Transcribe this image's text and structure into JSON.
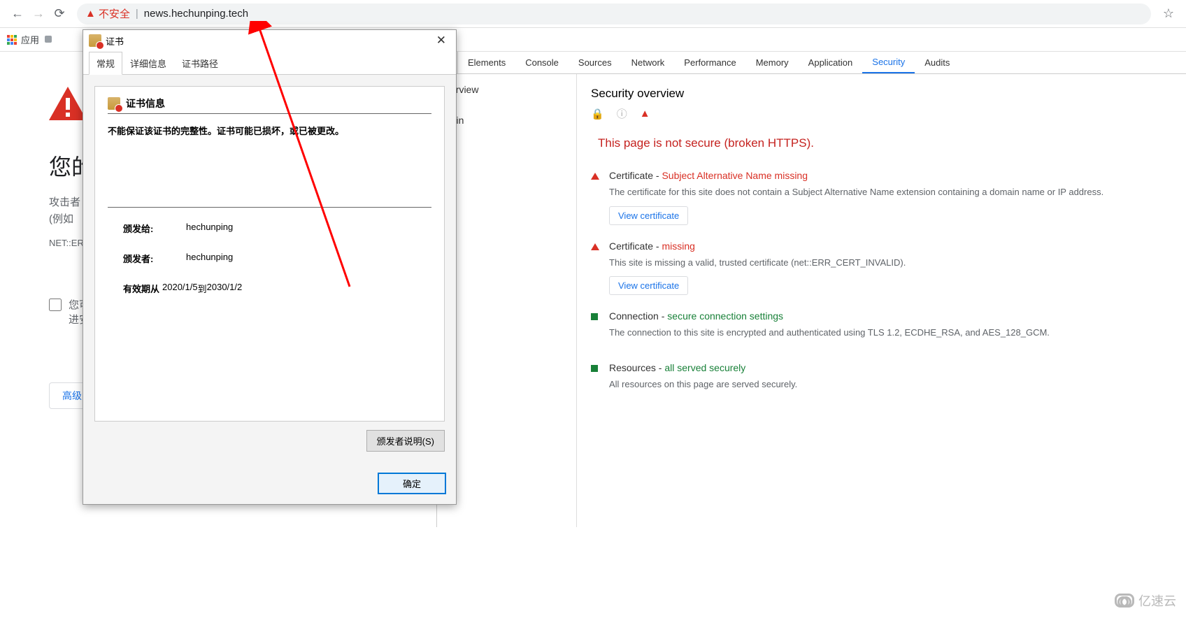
{
  "toolbar": {
    "not_secure": "不安全",
    "url": "news.hechunping.tech"
  },
  "bookmarks": {
    "apps": "应用"
  },
  "error_page": {
    "heading_partial": "您的",
    "desc_line1": "攻击者",
    "desc_line2": "(例如",
    "error_code_prefix": "NET::ER",
    "checkbox_line1": "您可",
    "checkbox_line2": "进安",
    "advanced": "高级"
  },
  "devtools": {
    "tabs": [
      "Elements",
      "Console",
      "Sources",
      "Network",
      "Performance",
      "Memory",
      "Application",
      "Security",
      "Audits"
    ],
    "active_tab": "Security",
    "sidebar": {
      "overview_partial": "verview",
      "origin_partial": "rigin"
    },
    "panel": {
      "heading": "Security overview",
      "page_status": "This page is not secure (broken HTTPS).",
      "items": [
        {
          "markClass": "red",
          "title_plain": "Certificate - ",
          "title_status": "Subject Alternative Name missing",
          "statusClass": "st-red",
          "desc": "The certificate for this site does not contain a Subject Alternative Name extension containing a domain name or IP address.",
          "button": "View certificate"
        },
        {
          "markClass": "red",
          "title_plain": "Certificate - ",
          "title_status": "missing",
          "statusClass": "st-red",
          "desc": "This site is missing a valid, trusted certificate (net::ERR_CERT_INVALID).",
          "button": "View certificate"
        },
        {
          "markClass": "green",
          "title_plain": "Connection - ",
          "title_status": "secure connection settings",
          "statusClass": "st-green",
          "desc": "The connection to this site is encrypted and authenticated using TLS 1.2, ECDHE_RSA, and AES_128_GCM.",
          "button": ""
        },
        {
          "markClass": "green",
          "title_plain": "Resources - ",
          "title_status": "all served securely",
          "statusClass": "st-green",
          "desc": "All resources on this page are served securely.",
          "button": ""
        }
      ]
    }
  },
  "cert_dialog": {
    "title": "证书",
    "tabs": [
      "常规",
      "详细信息",
      "证书路径"
    ],
    "info_heading": "证书信息",
    "warn_msg": "不能保证该证书的完整性。证书可能已损坏，或已被更改。",
    "issued_to_label": "颁发给:",
    "issued_to_value": "hechunping",
    "issued_by_label": "颁发者:",
    "issued_by_value": "hechunping",
    "valid_label": "有效期从 ",
    "valid_from": "2020/1/5",
    "valid_to_word": " 到 ",
    "valid_to": "2030/1/2",
    "issuer_stmt": "颁发者说明(S)",
    "ok": "确定"
  },
  "watermark": "亿速云"
}
